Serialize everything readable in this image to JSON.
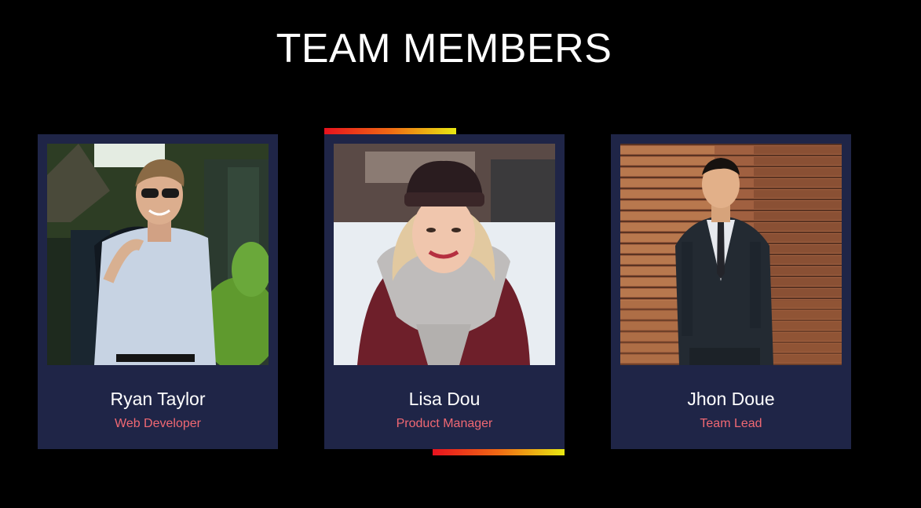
{
  "header": {
    "title": "TEAM MEMBERS"
  },
  "colors": {
    "background": "#000000",
    "card": "#1f2547",
    "name": "#ffffff",
    "role": "#f06873",
    "accent_gradient": [
      "#e8121e",
      "#f06a14",
      "#e8e812"
    ]
  },
  "members": [
    {
      "name": "Ryan Taylor",
      "role": "Web Developer",
      "photo": "man-in-sunglasses-portrait",
      "highlighted": false
    },
    {
      "name": "Lisa Dou",
      "role": "Product Manager",
      "photo": "woman-in-beanie-portrait",
      "highlighted": true
    },
    {
      "name": "Jhon Doue",
      "role": "Team Lead",
      "photo": "man-in-suit-portrait",
      "highlighted": false
    }
  ]
}
